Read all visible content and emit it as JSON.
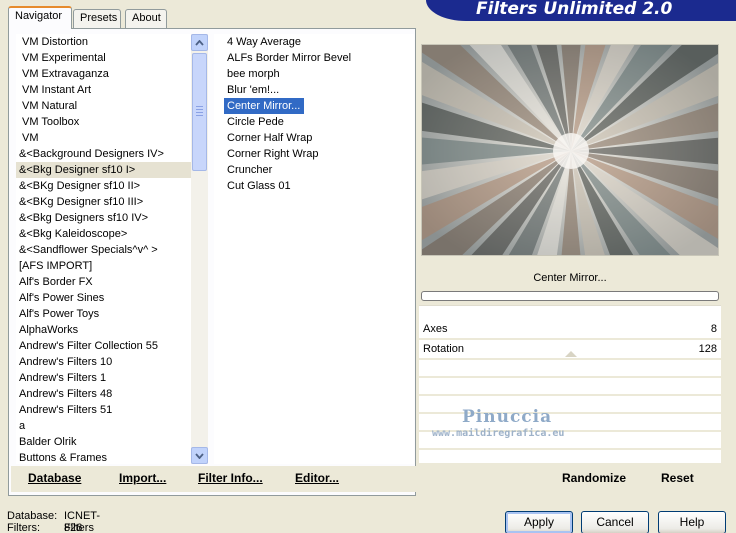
{
  "banner_title": "Filters Unlimited 2.0",
  "tabs": [
    {
      "label": "Navigator"
    },
    {
      "label": "Presets"
    },
    {
      "label": "About"
    }
  ],
  "categories": [
    "VM Distortion",
    "VM Experimental",
    "VM Extravaganza",
    "VM Instant Art",
    "VM Natural",
    "VM Toolbox",
    "VM",
    "&<Background Designers IV>",
    "&<Bkg Designer sf10 I>",
    "&<BKg Designer sf10 II>",
    "&<BKg Designer sf10 III>",
    "&<Bkg Designers sf10 IV>",
    "&<Bkg Kaleidoscope>",
    "&<Sandflower Specials^v^ >",
    "[AFS IMPORT]",
    "Alf's Border FX",
    "Alf's Power Sines",
    "Alf's Power Toys",
    "AlphaWorks",
    "Andrew's Filter Collection 55",
    "Andrew's Filters 10",
    "Andrew's Filters 1",
    "Andrew's Filters 48",
    "Andrew's Filters 51",
    "a",
    "Balder Olrik",
    "Buttons & Frames"
  ],
  "selected_category": "&<Bkg Designer sf10 I>",
  "filters": [
    "4 Way Average",
    "ALFs Border Mirror Bevel",
    "bee morph",
    "Blur 'em!...",
    "Center Mirror...",
    "Circle Pede",
    "Corner Half Wrap",
    "Corner Right Wrap",
    "Cruncher",
    "Cut Glass 01"
  ],
  "selected_filter": "Center Mirror...",
  "toolbar": {
    "database": "Database",
    "import": "Import...",
    "filter_info": "Filter Info...",
    "editor": "Editor...",
    "randomize": "Randomize",
    "reset": "Reset"
  },
  "filter_name": "Center Mirror...",
  "params": [
    {
      "label": "Axes",
      "value": "8"
    },
    {
      "label": "Rotation",
      "value": "128"
    }
  ],
  "watermark": {
    "name": "Pinuccia",
    "url": "www.maildiregrafica.eu"
  },
  "status": {
    "database_label": "Database:",
    "database_value": "ICNET-Filters",
    "filters_label": "Filters:",
    "filters_value": "826"
  },
  "buttons": {
    "apply": "Apply",
    "cancel": "Cancel",
    "help": "Help"
  },
  "colors": {
    "selection": "#316ac5",
    "banner": "#1b2a8f",
    "window_bg": "#ece9d8"
  }
}
